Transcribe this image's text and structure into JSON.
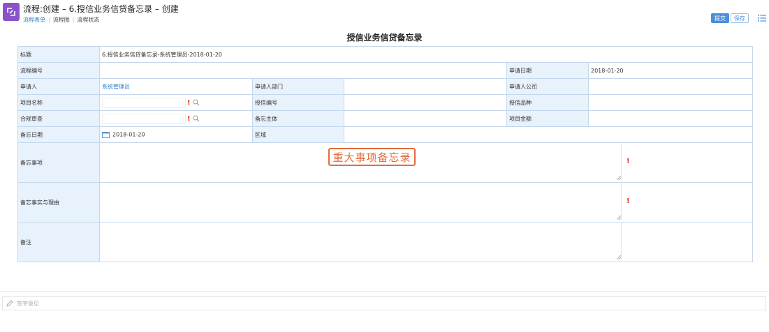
{
  "header": {
    "title": "流程:创建 – 6.授信业务信贷备忘录 – 创建",
    "tabs": [
      "流程表单",
      "流程图",
      "流程状态"
    ],
    "submit_label": "提交",
    "save_label": "保存"
  },
  "form": {
    "title": "授信业务信贷备忘录",
    "rows": {
      "title_label": "标题",
      "title_value": "6.授信业务信贷备忘录-系统管理员-2018-01-20",
      "flow_no_label": "流程编号",
      "apply_date_label": "申请日期",
      "apply_date_value": "2018-01-20",
      "applicant_label": "申请人",
      "applicant_value": "系统管理员",
      "applicant_dept_label": "申请人部门",
      "applicant_company_label": "申请人公司",
      "project_name_label": "项目名称",
      "credit_no_label": "授信编号",
      "credit_type_label": "授信品种",
      "compliance_label": "合规审查",
      "memo_subject_label": "备忘主体",
      "project_amount_label": "项目金额",
      "memo_date_label": "备忘日期",
      "memo_date_value": "2018-01-20",
      "region_label": "区域",
      "memo_items_label": "备忘事项",
      "memo_facts_label": "备忘事实与理由",
      "remarks_label": "备注"
    },
    "stamp_text": "重大事项备忘录"
  },
  "footer": {
    "opinion_placeholder": "签字意见"
  },
  "colors": {
    "brand": "#8a53c9",
    "accent": "#4a90d9",
    "label_bg": "#e8f2fc",
    "required": "#e0322b",
    "stamp": "#e36c3c"
  }
}
